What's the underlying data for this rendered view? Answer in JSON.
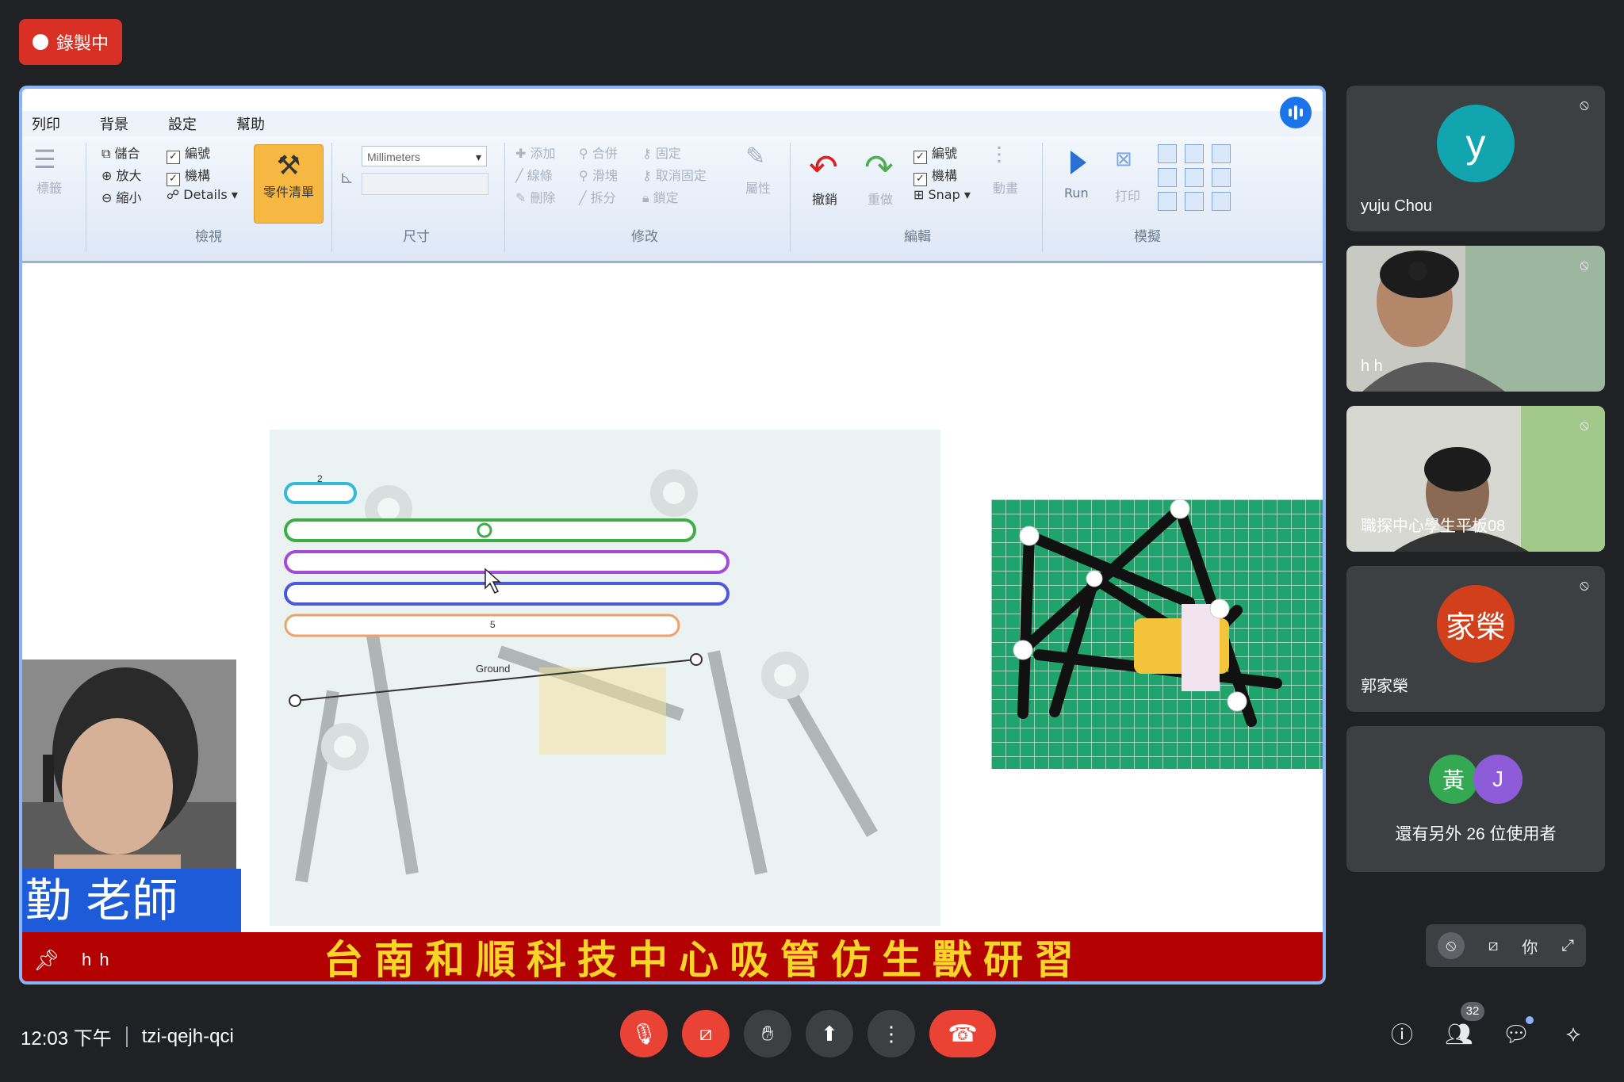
{
  "recording": {
    "label": "錄製中"
  },
  "ribbon": {
    "menu": [
      "列印",
      "背景",
      "設定",
      "幫助"
    ],
    "view": {
      "combine": "儲合",
      "zoom_in": "放大",
      "zoom_out": "縮小",
      "check1": "編號",
      "check2": "機構",
      "details": "Details",
      "group": "檢視"
    },
    "parts_list": "零件清單",
    "units": {
      "selected": "Millimeters",
      "group": "尺寸"
    },
    "edit": {
      "add": "添加",
      "merge": "合併",
      "fix": "固定",
      "line": "線條",
      "split_joint": "滑塊",
      "unfix": "取消固定",
      "delete": "刪除",
      "split": "拆分",
      "lock": "鎖定",
      "props": "屬性",
      "group": "修改"
    },
    "undo": {
      "undo": "撤銷",
      "redo": "重做",
      "check1": "編號",
      "check2": "機構",
      "snap": "Snap",
      "slider": "動畫",
      "group": "編輯"
    },
    "run": {
      "run": "Run",
      "print": "打印",
      "group": "模擬"
    }
  },
  "canvas": {
    "ground_label": "Ground",
    "link_labels": [
      "2",
      "5"
    ]
  },
  "presenter": {
    "name_plate": "勤 老師"
  },
  "banner": {
    "user": "h h",
    "title": "台南和順科技中心吸管仿生獸研習"
  },
  "participants": [
    {
      "name": "yuju Chou",
      "initial": "y",
      "color": "#12a4af"
    },
    {
      "name": "h h"
    },
    {
      "name": "職探中心學生平板08"
    },
    {
      "name": "郭家榮",
      "initial": "家榮",
      "color": "#d2401b"
    }
  ],
  "more_users": {
    "avatars": [
      {
        "initial": "黃",
        "color": "#34a853"
      },
      {
        "initial": "J",
        "color": "#8e5cd9"
      }
    ],
    "label": "還有另外 26 位使用者"
  },
  "self_view": {
    "label": "你"
  },
  "bottom": {
    "time": "12:03 下午",
    "meeting_code": "tzi-qejh-qci",
    "participant_count": "32"
  }
}
